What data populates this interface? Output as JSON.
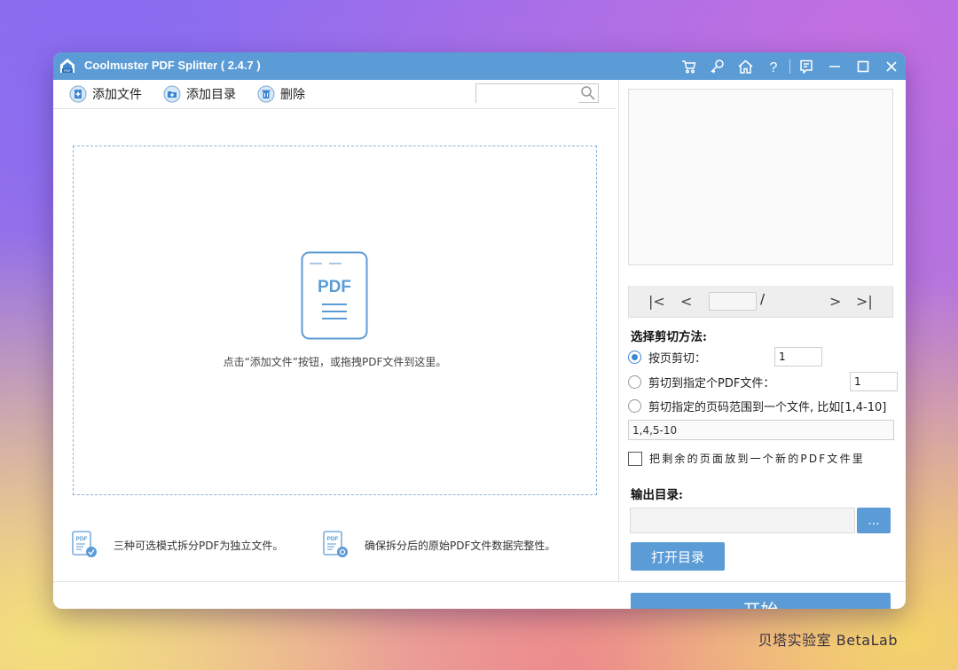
{
  "window": {
    "title": "Coolmuster PDF Splitter  ( 2.4.7 )",
    "accent_color": "#5b9bd6",
    "title_icons": [
      "cart-icon",
      "key-icon",
      "home-icon",
      "help-icon",
      "feedback-icon",
      "minimize-icon",
      "maximize-icon",
      "close-icon"
    ]
  },
  "toolbar": {
    "add_file": "添加文件",
    "add_dir": "添加目录",
    "delete": "删除",
    "search_placeholder": ""
  },
  "dropzone": {
    "icon_label": "PDF",
    "hint": "点击“添加文件”按钮，或拖拽PDF文件到这里。"
  },
  "features": [
    {
      "icon_label": "PDF",
      "text": "三种可选模式拆分PDF为独立文件。"
    },
    {
      "icon_label": "PDF",
      "text": "确保拆分后的原始PDF文件数据完整性。"
    }
  ],
  "preview": {
    "page_value": "",
    "slash": "/"
  },
  "split": {
    "title": "选择剪切方法:",
    "option1_label": "按页剪切：",
    "option1_value": "1",
    "option2_label": "剪切到指定个PDF文件：",
    "option2_value": "1",
    "option3_label": "剪切指定的页码范围到一个文件, 比如[1,4-10]",
    "range_value": "1,4,5-10",
    "remaining_label": "把剩余的页面放到一个新的PDF文件里",
    "selected_option": 1
  },
  "output": {
    "title": "输出目录:",
    "path": "",
    "browse_label": "...",
    "open_label": "打开目录",
    "start_label": "开始"
  },
  "watermark": "贝塔实验室 BetaLab"
}
